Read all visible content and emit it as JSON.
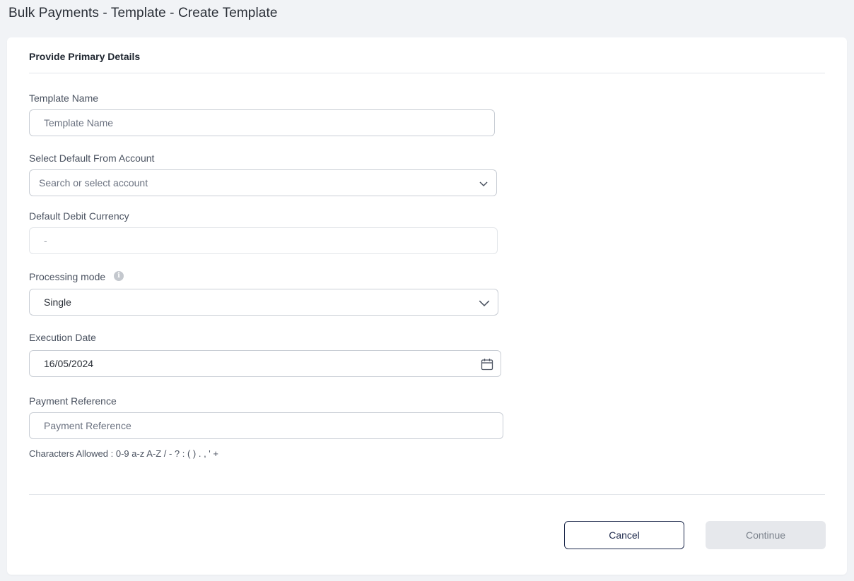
{
  "page": {
    "title": "Bulk Payments - Template - Create Template"
  },
  "section": {
    "title": "Provide Primary Details"
  },
  "fields": {
    "template_name": {
      "label": "Template Name",
      "placeholder": "Template Name",
      "value": ""
    },
    "from_account": {
      "label": "Select Default From Account",
      "placeholder": "Search or select account"
    },
    "debit_currency": {
      "label": "Default Debit Currency",
      "value": "-"
    },
    "processing_mode": {
      "label": "Processing mode",
      "info_icon": "i",
      "value": "Single"
    },
    "execution_date": {
      "label": "Execution Date",
      "value": "16/05/2024"
    },
    "payment_reference": {
      "label": "Payment Reference",
      "placeholder": "Payment Reference",
      "value": "",
      "hint": "Characters Allowed : 0-9 a-z A-Z / - ? : ( ) . , ' +"
    }
  },
  "actions": {
    "cancel_label": "Cancel",
    "continue_label": "Continue"
  },
  "colors": {
    "background": "#f1f3f6",
    "card": "#ffffff",
    "border": "#c9ced5",
    "primary_outline": "#1f2b4d",
    "disabled_button": "#e6e8ec"
  },
  "icons": {
    "chevron": "chevron-down-icon",
    "calendar": "calendar-icon",
    "info": "info-icon"
  }
}
